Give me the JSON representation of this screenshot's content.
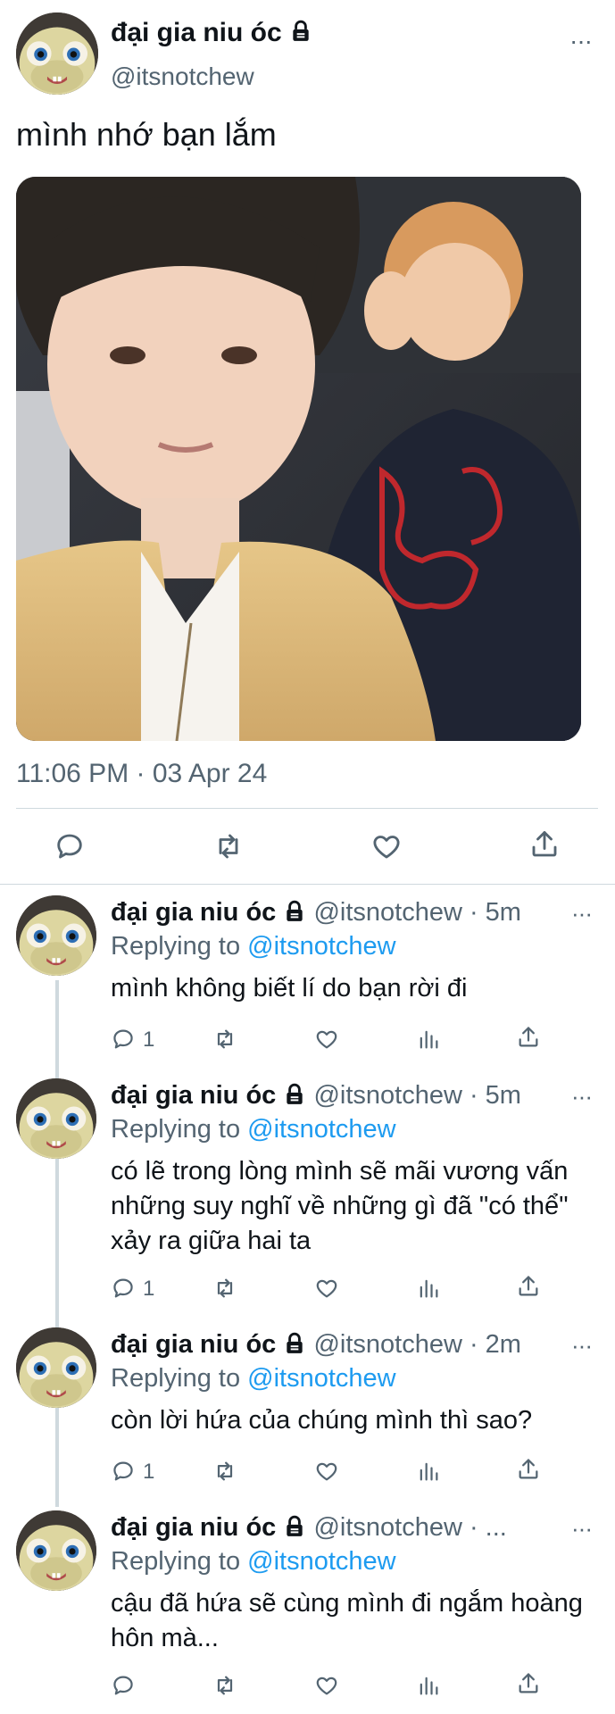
{
  "main_tweet": {
    "display_name": "đại gia niu óc",
    "handle": "@itsnotchew",
    "text": "mình nhớ bạn lắm",
    "timestamp": "11:06 PM · 03 Apr 24",
    "more": "···"
  },
  "replies": [
    {
      "display_name": "đại gia niu óc",
      "handle": "@itsnotchew",
      "time": "· 5m",
      "replying_prefix": "Replying to",
      "replying_to": "@itsnotchew",
      "text": "mình không biết lí do bạn rời đi",
      "reply_count": "1"
    },
    {
      "display_name": "đại gia niu óc",
      "handle": "@itsnotchew",
      "time": "· 5m",
      "replying_prefix": "Replying to",
      "replying_to": "@itsnotchew",
      "text": "có lẽ trong lòng mình sẽ mãi vương vấn những suy nghĩ về những gì đã \"có thể\" xảy ra giữa hai ta",
      "reply_count": "1"
    },
    {
      "display_name": "đại gia niu óc",
      "handle": "@itsnotchew",
      "time": "· 2m",
      "replying_prefix": "Replying to",
      "replying_to": "@itsnotchew",
      "text": "còn lời hứa của chúng mình thì sao?",
      "reply_count": "1"
    },
    {
      "display_name": "đại gia niu óc",
      "handle": "@itsnotchew",
      "time": "· ...",
      "replying_prefix": "Replying to",
      "replying_to": "@itsnotchew",
      "text": "cậu đã hứa sẽ cùng mình đi ngắm hoàng hôn mà...",
      "reply_count": ""
    }
  ],
  "icons": {
    "lock": "lock-icon",
    "reply": "reply-icon",
    "retweet": "retweet-icon",
    "like": "like-icon",
    "views": "views-icon",
    "share": "share-icon",
    "more": "more-icon"
  },
  "colors": {
    "link": "#1d9bf0",
    "muted": "#536471",
    "text": "#0f1419",
    "divider": "#cfd9de"
  }
}
